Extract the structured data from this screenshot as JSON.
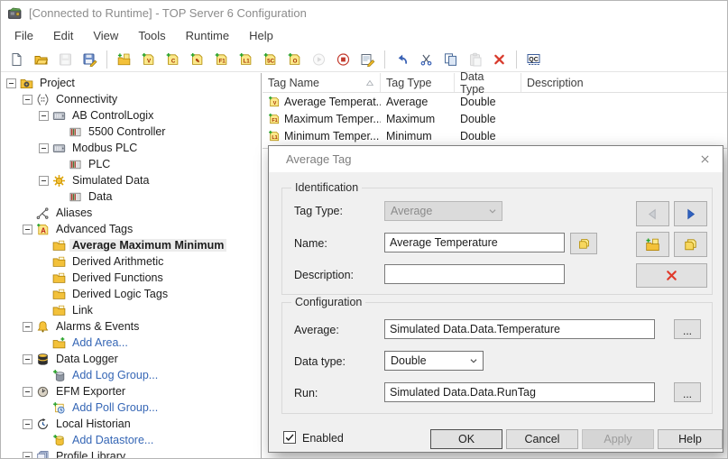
{
  "window": {
    "title": "[Connected to Runtime] - TOP Server 6 Configuration"
  },
  "menu": {
    "items": [
      {
        "name": "file",
        "label": "File"
      },
      {
        "name": "edit",
        "label": "Edit"
      },
      {
        "name": "view",
        "label": "View"
      },
      {
        "name": "tools",
        "label": "Tools"
      },
      {
        "name": "runtime",
        "label": "Runtime"
      },
      {
        "name": "help",
        "label": "Help"
      }
    ]
  },
  "toolbar": {
    "buttons": [
      {
        "name": "new-project",
        "icon": "doc"
      },
      {
        "name": "open-project",
        "icon": "folder-open"
      },
      {
        "name": "save-project",
        "icon": "floppy",
        "disabled": true
      },
      {
        "name": "save-as",
        "icon": "floppy-edit"
      },
      {
        "separator": true
      },
      {
        "name": "new-channel",
        "icon": "folder-note-plus"
      },
      {
        "name": "new-average-tag",
        "icon": "note:V"
      },
      {
        "name": "new-complex-tag",
        "icon": "note:C"
      },
      {
        "name": "new-derived-tag",
        "icon": "note:✎"
      },
      {
        "name": "new-maximum-tag",
        "icon": "note:F1"
      },
      {
        "name": "new-minimum-tag",
        "icon": "note:L1"
      },
      {
        "name": "new-link-tag",
        "icon": "note:5C"
      },
      {
        "name": "new-oracle-tag",
        "icon": "note:O"
      },
      {
        "name": "start-runtime",
        "icon": "play",
        "disabled": true
      },
      {
        "name": "stop-runtime",
        "icon": "stop"
      },
      {
        "name": "edit-properties",
        "icon": "form-edit"
      },
      {
        "separator": true
      },
      {
        "name": "undo",
        "icon": "undo"
      },
      {
        "name": "cut",
        "icon": "scissors"
      },
      {
        "name": "copy",
        "icon": "copy"
      },
      {
        "name": "paste",
        "icon": "paste",
        "disabled": true
      },
      {
        "name": "delete",
        "icon": "delete-x"
      },
      {
        "separator": true
      },
      {
        "name": "quick-client",
        "icon": "qc"
      }
    ]
  },
  "tree": {
    "items": [
      {
        "name": "project",
        "label": "Project",
        "icon": "folder-gear",
        "indent": 0,
        "expander": true
      },
      {
        "name": "connectivity",
        "label": "Connectivity",
        "icon": "connectivity",
        "indent": 1,
        "expander": true
      },
      {
        "name": "ab-controllogix",
        "label": "AB ControlLogix",
        "icon": "device",
        "indent": 2,
        "expander": true
      },
      {
        "name": "5500-controller",
        "label": "5500 Controller",
        "icon": "plc",
        "indent": 3
      },
      {
        "name": "modbus-plc",
        "label": "Modbus PLC",
        "icon": "device",
        "indent": 2,
        "expander": true
      },
      {
        "name": "plc",
        "label": "PLC",
        "icon": "plc",
        "indent": 3
      },
      {
        "name": "simulated-data",
        "label": "Simulated Data",
        "icon": "gear",
        "indent": 2,
        "expander": true
      },
      {
        "name": "data",
        "label": "Data",
        "icon": "plc",
        "indent": 3
      },
      {
        "name": "aliases",
        "label": "Aliases",
        "icon": "aliases",
        "indent": 1
      },
      {
        "name": "advanced-tags",
        "label": "Advanced Tags",
        "icon": "advanced-tags",
        "indent": 1,
        "expander": true
      },
      {
        "name": "average-maximum-minimum",
        "label": "Average Maximum Minimum",
        "icon": "folder-tag",
        "indent": 2,
        "selected": true
      },
      {
        "name": "derived-arithmetic",
        "label": "Derived Arithmetic",
        "icon": "folder-tag",
        "indent": 2
      },
      {
        "name": "derived-functions",
        "label": "Derived Functions",
        "icon": "folder-tag",
        "indent": 2
      },
      {
        "name": "derived-logic-tags",
        "label": "Derived Logic Tags",
        "icon": "folder-tag",
        "indent": 2
      },
      {
        "name": "link",
        "label": "Link",
        "icon": "folder-tag",
        "indent": 2
      },
      {
        "name": "alarms-events",
        "label": "Alarms & Events",
        "icon": "bell",
        "indent": 1,
        "expander": true
      },
      {
        "name": "add-area",
        "label": "Add Area...",
        "icon": "folder-plus",
        "indent": 2,
        "link": true
      },
      {
        "name": "data-logger",
        "label": "Data Logger",
        "icon": "database",
        "indent": 1,
        "expander": true
      },
      {
        "name": "add-log-group",
        "label": "Add Log Group...",
        "icon": "database-plus",
        "indent": 2,
        "link": true
      },
      {
        "name": "efm-exporter",
        "label": "EFM Exporter",
        "icon": "gauge",
        "indent": 1,
        "expander": true
      },
      {
        "name": "add-poll-group",
        "label": "Add Poll Group...",
        "icon": "poll-plus",
        "indent": 2,
        "link": true
      },
      {
        "name": "local-historian",
        "label": "Local Historian",
        "icon": "history",
        "indent": 1,
        "expander": true
      },
      {
        "name": "add-datastore",
        "label": "Add Datastore...",
        "icon": "datastore-plus",
        "indent": 2,
        "link": true
      },
      {
        "name": "profile-library",
        "label": "Profile Library",
        "icon": "books",
        "indent": 1,
        "expander": true
      }
    ]
  },
  "grid": {
    "columns": [
      {
        "name": "tag-name",
        "label": "Tag Name",
        "sorted": true
      },
      {
        "name": "tag-type",
        "label": "Tag Type"
      },
      {
        "name": "data-type",
        "label": "Data Type"
      },
      {
        "name": "description",
        "label": "Description"
      }
    ],
    "rows": [
      {
        "name": "average-temperature",
        "icon": "note:V",
        "cells": [
          "Average Temperat...",
          "Average",
          "Double",
          ""
        ]
      },
      {
        "name": "maximum-temperature",
        "icon": "note:F1",
        "cells": [
          "Maximum Temper...",
          "Maximum",
          "Double",
          ""
        ]
      },
      {
        "name": "minimum-temperature",
        "icon": "note:L1",
        "cells": [
          "Minimum Temper...",
          "Minimum",
          "Double",
          ""
        ]
      }
    ]
  },
  "dialog": {
    "title": "Average Tag",
    "identification": {
      "label": "Identification",
      "tag_type_label": "Tag Type:",
      "tag_type_value": "Average",
      "name_label": "Name:",
      "name_value": "Average Temperature",
      "description_label": "Description:",
      "description_value": ""
    },
    "configuration": {
      "label": "Configuration",
      "average_label": "Average:",
      "average_value": "Simulated Data.Data.Temperature",
      "data_type_label": "Data type:",
      "data_type_value": "Double",
      "run_label": "Run:",
      "run_value": "Simulated Data.Data.RunTag",
      "browse_label": "..."
    },
    "footer": {
      "enabled_label": "Enabled",
      "enabled_checked": true,
      "ok": "OK",
      "cancel": "Cancel",
      "apply": "Apply",
      "help": "Help"
    }
  },
  "colors": {
    "link_blue": "#3566b5",
    "selection_bg": "#ececec",
    "delete_red": "#d8392b",
    "accent_blue": "#2f62c2",
    "disabled_text": "#9c9c9c",
    "title_gray": "#8c8c8c",
    "note_yellow": "#fbe88a"
  }
}
